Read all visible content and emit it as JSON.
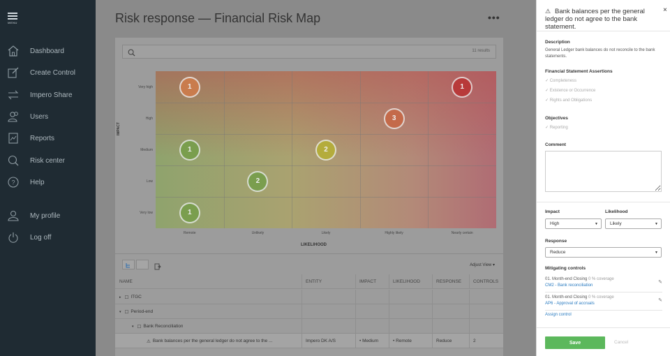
{
  "sidebar": {
    "menu_label": "MENU",
    "items": [
      {
        "label": "Dashboard",
        "icon": "home-icon"
      },
      {
        "label": "Create Control",
        "icon": "edit-icon"
      },
      {
        "label": "Impero Share",
        "icon": "swap-icon"
      },
      {
        "label": "Users",
        "icon": "users-icon"
      },
      {
        "label": "Reports",
        "icon": "report-icon"
      },
      {
        "label": "Risk center",
        "icon": "search-icon"
      },
      {
        "label": "Help",
        "icon": "help-icon"
      },
      {
        "label": "My profile",
        "icon": "user-icon"
      },
      {
        "label": "Log off",
        "icon": "power-icon"
      }
    ]
  },
  "main": {
    "title": "Risk response — Financial Risk Map",
    "more": "•••",
    "results": "11 results"
  },
  "chart_data": {
    "type": "heatmap",
    "xlabel": "LIKELIHOOD",
    "ylabel": "IMPACT",
    "x_categories": [
      "Remote",
      "Unlikely",
      "Likely",
      "Highly likely",
      "Nearly certain"
    ],
    "y_categories": [
      "Very high",
      "High",
      "Medium",
      "Low",
      "Very low"
    ],
    "bubbles": [
      {
        "x": "Remote",
        "y": "Very high",
        "count": 1,
        "color": "#c97c4d"
      },
      {
        "x": "Nearly certain",
        "y": "Very high",
        "count": 1,
        "color": "#b83a3a"
      },
      {
        "x": "Highly likely",
        "y": "High",
        "count": 3,
        "color": "#c46a4a"
      },
      {
        "x": "Remote",
        "y": "Medium",
        "count": 1,
        "color": "#7a9e4e"
      },
      {
        "x": "Likely",
        "y": "Medium",
        "count": 2,
        "color": "#b4ac3c"
      },
      {
        "x": "Unlikely",
        "y": "Low",
        "count": 2,
        "color": "#7a9e4e"
      },
      {
        "x": "Remote",
        "y": "Very low",
        "count": 1,
        "color": "#7a9e4e"
      }
    ]
  },
  "toolbar": {
    "adjust_view": "Adjust View ▾"
  },
  "table": {
    "headers": [
      "NAME",
      "ENTITY",
      "IMPACT",
      "LIKELIHOOD",
      "RESPONSE",
      "CONTROLS"
    ],
    "rows": [
      {
        "toggle": "▸",
        "icon": "☐",
        "name": "ITGC",
        "entity": "",
        "impact": "",
        "likelihood": "",
        "response": "",
        "controls": ""
      },
      {
        "toggle": "▾",
        "icon": "☐",
        "name": "Period-end",
        "entity": "",
        "impact": "",
        "likelihood": "",
        "response": "",
        "controls": ""
      },
      {
        "toggle": "▾",
        "icon": "☐",
        "name": "Bank Reconciliation",
        "entity": "",
        "impact": "",
        "likelihood": "",
        "response": "",
        "controls": ""
      },
      {
        "toggle": "",
        "icon": "⚠",
        "name": "Bank balances per the general ledger do not agree to the ...",
        "entity": "Impero DK A/S",
        "impact": "• Medium",
        "likelihood": "• Remote",
        "response": "Reduce",
        "controls": "2"
      }
    ]
  },
  "panel": {
    "title": "Bank balances per the general ledger do not agree to the bank statement.",
    "close": "×",
    "description_h": "Description",
    "description": "General Ledger bank balances do not reconcile to the bank statements.",
    "assertions_h": "Financial Statement Assertions",
    "assertions": [
      "Completeness",
      "Existence or Occurrence",
      "Rights and Obligations"
    ],
    "objectives_h": "Objectives",
    "objectives": [
      "Reporting"
    ],
    "comment_h": "Comment",
    "impact_h": "Impact",
    "impact_value": "High",
    "likelihood_h": "Likelihood",
    "likelihood_value": "Likely",
    "response_h": "Response",
    "response_value": "Reduce",
    "mitigating_h": "Mitigating controls",
    "controls": [
      {
        "name": "01. Month-end Closing",
        "coverage": "0 % coverage",
        "link": "CM2 - Bank reconciliation"
      },
      {
        "name": "01. Month-end Closing",
        "coverage": "0 % coverage",
        "link": "AP6 - Approval of accruals"
      }
    ],
    "assign": "Assign control",
    "save": "Save",
    "cancel": "Cancel"
  }
}
